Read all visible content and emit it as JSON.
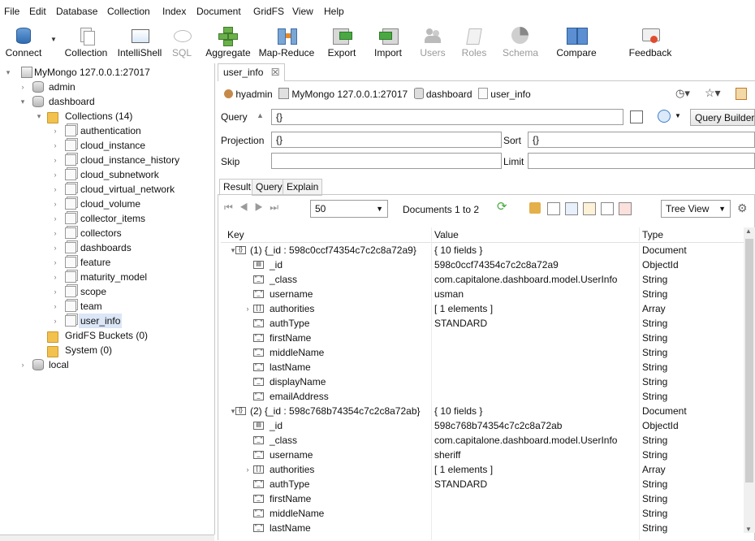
{
  "menubar": {
    "items": [
      "File",
      "Edit",
      "Database",
      "Collection",
      "Index",
      "Document",
      "GridFS",
      "View",
      "Help"
    ]
  },
  "toolbar": {
    "buttons": [
      {
        "label": "Connect",
        "icon": "connect-icon",
        "enabled": true
      },
      {
        "label": "Collection",
        "icon": "collection-icon",
        "enabled": true
      },
      {
        "label": "IntelliShell",
        "icon": "intellishell-icon",
        "enabled": true
      },
      {
        "label": "SQL",
        "icon": "sql-icon",
        "enabled": false
      },
      {
        "label": "Aggregate",
        "icon": "aggregate-icon",
        "enabled": true
      },
      {
        "label": "Map-Reduce",
        "icon": "map-reduce-icon",
        "enabled": true
      },
      {
        "label": "Export",
        "icon": "export-icon",
        "enabled": true
      },
      {
        "label": "Import",
        "icon": "import-icon",
        "enabled": true
      },
      {
        "label": "Users",
        "icon": "users-icon",
        "enabled": false
      },
      {
        "label": "Roles",
        "icon": "roles-icon",
        "enabled": false
      },
      {
        "label": "Schema",
        "icon": "schema-icon",
        "enabled": false
      },
      {
        "label": "Compare",
        "icon": "compare-icon",
        "enabled": true
      },
      {
        "label": "Feedback",
        "icon": "feedback-icon",
        "enabled": true
      }
    ]
  },
  "tree": {
    "server": "MyMongo 127.0.0.1:27017",
    "admin": "admin",
    "dashboard": "dashboard",
    "collections_folder": "Collections (14)",
    "collections": [
      "authentication",
      "cloud_instance",
      "cloud_instance_history",
      "cloud_subnetwork",
      "cloud_virtual_network",
      "cloud_volume",
      "collector_items",
      "collectors",
      "dashboards",
      "feature",
      "maturity_model",
      "scope",
      "team",
      "user_info"
    ],
    "selected": "user_info",
    "gridfs": "GridFS Buckets (0)",
    "system": "System (0)",
    "local": "local"
  },
  "tab": {
    "title": "user_info"
  },
  "breadcrumb": {
    "user": "hyadmin",
    "server": "MyMongo 127.0.0.1:27017",
    "database": "dashboard",
    "collection": "user_info"
  },
  "query": {
    "query_label": "Query",
    "query_value": "{}",
    "projection_label": "Projection",
    "projection_value": "{}",
    "sort_label": "Sort",
    "sort_value": "{}",
    "skip_label": "Skip",
    "skip_value": "",
    "limit_label": "Limit",
    "limit_value": "",
    "builder_button": "Query Builder"
  },
  "subtabs": [
    "Result",
    "Query",
    "Explain"
  ],
  "results": {
    "page_size": "50",
    "range_text": "Documents 1 to 2",
    "view_mode": "Tree View",
    "columns": [
      "Key",
      "Value",
      "Type"
    ],
    "rows": [
      {
        "indent": 0,
        "expand": "open",
        "icon": "doc",
        "key": "(1) {_id : 598c0ccf74354c7c2c8a72a9}",
        "value": "{ 10 fields }",
        "type": "Document"
      },
      {
        "indent": 1,
        "expand": "",
        "icon": "id",
        "key": "_id",
        "value": "598c0ccf74354c7c2c8a72a9",
        "type": "ObjectId"
      },
      {
        "indent": 1,
        "expand": "",
        "icon": "str",
        "key": "_class",
        "value": "com.capitalone.dashboard.model.UserInfo",
        "type": "String"
      },
      {
        "indent": 1,
        "expand": "",
        "icon": "str",
        "key": "username",
        "value": "usman",
        "type": "String"
      },
      {
        "indent": 1,
        "expand": "closed",
        "icon": "arr",
        "key": "authorities",
        "value": "[ 1 elements ]",
        "type": "Array"
      },
      {
        "indent": 1,
        "expand": "",
        "icon": "str",
        "key": "authType",
        "value": "STANDARD",
        "type": "String"
      },
      {
        "indent": 1,
        "expand": "",
        "icon": "str",
        "key": "firstName",
        "value": "",
        "type": "String"
      },
      {
        "indent": 1,
        "expand": "",
        "icon": "str",
        "key": "middleName",
        "value": "",
        "type": "String"
      },
      {
        "indent": 1,
        "expand": "",
        "icon": "str",
        "key": "lastName",
        "value": "",
        "type": "String"
      },
      {
        "indent": 1,
        "expand": "",
        "icon": "str",
        "key": "displayName",
        "value": "",
        "type": "String"
      },
      {
        "indent": 1,
        "expand": "",
        "icon": "str",
        "key": "emailAddress",
        "value": "",
        "type": "String"
      },
      {
        "indent": 0,
        "expand": "open",
        "icon": "doc",
        "key": "(2) {_id : 598c768b74354c7c2c8a72ab}",
        "value": "{ 10 fields }",
        "type": "Document"
      },
      {
        "indent": 1,
        "expand": "",
        "icon": "id",
        "key": "_id",
        "value": "598c768b74354c7c2c8a72ab",
        "type": "ObjectId"
      },
      {
        "indent": 1,
        "expand": "",
        "icon": "str",
        "key": "_class",
        "value": "com.capitalone.dashboard.model.UserInfo",
        "type": "String"
      },
      {
        "indent": 1,
        "expand": "",
        "icon": "str",
        "key": "username",
        "value": "sheriff",
        "type": "String"
      },
      {
        "indent": 1,
        "expand": "closed",
        "icon": "arr",
        "key": "authorities",
        "value": "[ 1 elements ]",
        "type": "Array"
      },
      {
        "indent": 1,
        "expand": "",
        "icon": "str",
        "key": "authType",
        "value": "STANDARD",
        "type": "String"
      },
      {
        "indent": 1,
        "expand": "",
        "icon": "str",
        "key": "firstName",
        "value": "",
        "type": "String"
      },
      {
        "indent": 1,
        "expand": "",
        "icon": "str",
        "key": "middleName",
        "value": "",
        "type": "String"
      },
      {
        "indent": 1,
        "expand": "",
        "icon": "str",
        "key": "lastName",
        "value": "",
        "type": "String"
      }
    ]
  },
  "colors": {
    "selection": "#dbe6f6",
    "border": "#c8c8c8",
    "folder": "#f2c14e",
    "accent": "#3c7fc8"
  }
}
